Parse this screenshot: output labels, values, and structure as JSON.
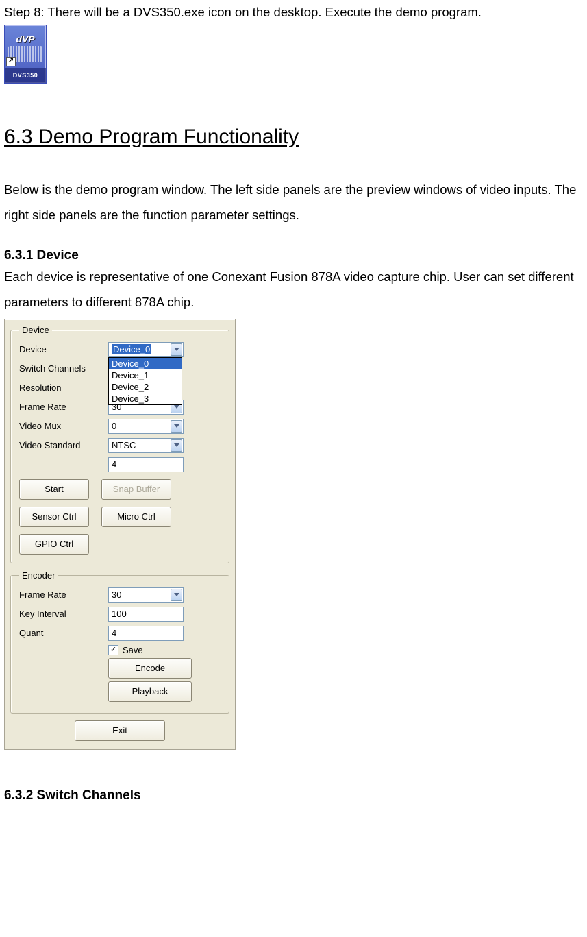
{
  "step8": "Step 8: There will be a DVS350.exe icon on the desktop. Execute the demo program.",
  "desktop_icon": {
    "app_letters": "dVP",
    "label": "DVS350",
    "shortcut_glyph": "↗"
  },
  "section_heading": "6.3 Demo Program Functionality",
  "intro_para": "Below is the demo program window. The left side panels are the preview windows of video inputs. The right side panels are the function parameter settings.",
  "sub_631_heading": "6.3.1 Device",
  "sub_631_text": "Each device is representative of one Conexant Fusion 878A video capture chip. User can set different parameters to different 878A chip.",
  "panel": {
    "device_group": {
      "legend": "Device",
      "labels": {
        "device": "Device",
        "switch_channels": "Switch Channels",
        "resolution": "Resolution",
        "frame_rate": "Frame Rate",
        "video_mux": "Video Mux",
        "video_standard": "Video Standard"
      },
      "device_selected": "Device_0",
      "device_options": [
        "Device_0",
        "Device_1",
        "Device_2",
        "Device_3"
      ],
      "switch_channels_value": "",
      "resolution_value": "",
      "frame_rate_value": "30",
      "video_mux_value": "0",
      "video_standard_value": "NTSC",
      "extra_text_value": "4",
      "buttons": {
        "start": "Start",
        "snap_buffer": "Snap Buffer",
        "sensor_ctrl": "Sensor Ctrl",
        "micro_ctrl": "Micro Ctrl",
        "gpio_ctrl": "GPIO Ctrl"
      }
    },
    "encoder_group": {
      "legend": "Encoder",
      "labels": {
        "frame_rate": "Frame Rate",
        "key_interval": "Key Interval",
        "quant": "Quant"
      },
      "frame_rate_value": "30",
      "key_interval_value": "100",
      "quant_value": "4",
      "save_checked": true,
      "save_label": "Save",
      "buttons": {
        "encode": "Encode",
        "playback": "Playback"
      }
    },
    "exit_button": "Exit"
  },
  "sub_632_heading": "6.3.2 Switch Channels"
}
